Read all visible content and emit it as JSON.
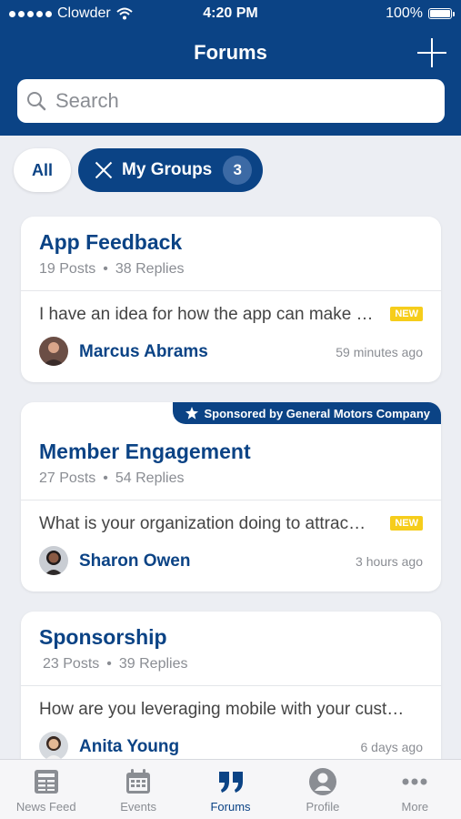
{
  "status_bar": {
    "carrier": "Clowder",
    "time": "4:20 PM",
    "battery": "100%"
  },
  "header": {
    "title": "Forums",
    "add_icon": "plus-icon",
    "search_placeholder": "Search"
  },
  "filters": {
    "all_label": "All",
    "groups_label": "My Groups",
    "groups_count": "3"
  },
  "forums": [
    {
      "title": "App Feedback",
      "posts": "19 Posts",
      "replies": "38 Replies",
      "preview": "I have an idea for how the app can make …",
      "badge": "NEW",
      "author": "Marcus Abrams",
      "time": "59 minutes ago"
    },
    {
      "sponsor": "Sponsored by General Motors Company",
      "title": "Member Engagement",
      "posts": "27 Posts",
      "replies": "54 Replies",
      "preview": "What is your organization doing to attrac…",
      "badge": "NEW",
      "author": "Sharon Owen",
      "time": "3 hours ago"
    },
    {
      "title": "Sponsorship",
      "posts": "23 Posts",
      "replies": "39 Replies",
      "preview": "How are you leveraging mobile with your cust…",
      "author": "Anita Young",
      "time": "6 days ago"
    }
  ],
  "tabbar": [
    {
      "label": "News Feed",
      "icon": "newspaper-icon"
    },
    {
      "label": "Events",
      "icon": "calendar-icon"
    },
    {
      "label": "Forums",
      "icon": "quote-icon",
      "active": true
    },
    {
      "label": "Profile",
      "icon": "person-icon"
    },
    {
      "label": "More",
      "icon": "more-dots-icon"
    }
  ],
  "colors": {
    "brand": "#0b4385",
    "badge": "#f6cd1b",
    "background": "#eceef3"
  }
}
